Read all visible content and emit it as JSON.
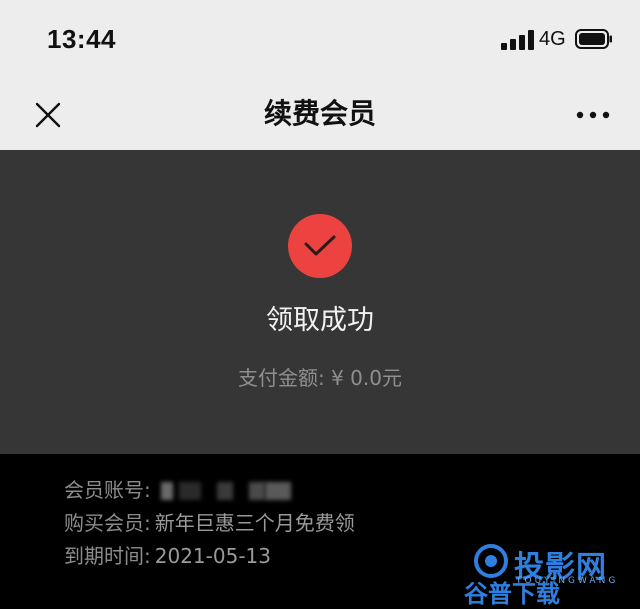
{
  "status_bar": {
    "time": "13:44",
    "network": "4G",
    "signal_icon": "cellular-signal-icon",
    "battery_icon": "battery-icon"
  },
  "nav": {
    "title": "续费会员",
    "close_icon": "close-icon",
    "more_icon": "more-icon"
  },
  "result": {
    "icon": "checkmark-icon",
    "message": "领取成功",
    "amount_text": "支付金额: ¥ 0.0元"
  },
  "details": {
    "account_label": "会员账号:",
    "purchase_label": "购买会员:",
    "purchase_value": "新年巨惠三个月免费领",
    "expiry_label": "到期时间:",
    "expiry_value": "2021-05-13"
  },
  "watermark": {
    "brand": "投影网",
    "sub": "TOUYINGWANG",
    "bottom": "谷普下载"
  },
  "colors": {
    "top_bar": "#ededed",
    "card": "#363636",
    "background": "#000000",
    "success": "#ec4340",
    "watermark": "#2f7fe0"
  }
}
